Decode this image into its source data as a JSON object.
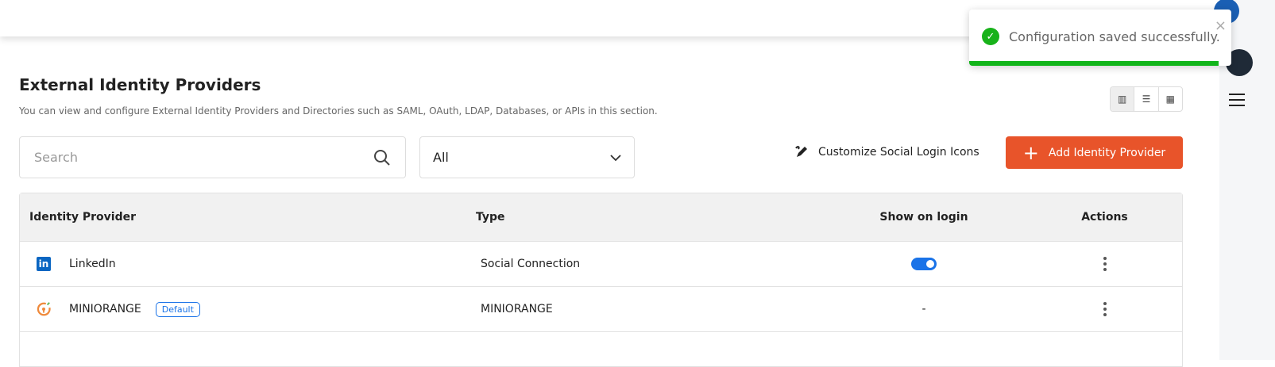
{
  "toast": {
    "message": "Configuration saved successfully.",
    "close": "×",
    "check": "✓",
    "progress": 0.95
  },
  "page": {
    "title": "External Identity Providers",
    "subtitle": "You can view and configure External Identity Providers and Directories such as SAML, OAuth, LDAP, Databases, or APIs in this section."
  },
  "search": {
    "placeholder": "Search"
  },
  "filter": {
    "selected": "All"
  },
  "actions": {
    "customize": "Customize Social Login Icons",
    "add": "Add Identity Provider",
    "plus": "+"
  },
  "table": {
    "headers": [
      "Identity Provider",
      "Type",
      "Show on login",
      "Actions"
    ],
    "rows": [
      {
        "name": "LinkedIn",
        "icon": "in",
        "badge": "",
        "type": "Social Connection",
        "show": true,
        "show_text": ""
      },
      {
        "name": "MINIORANGE",
        "icon": "",
        "badge": "Default",
        "type": "MINIORANGE",
        "show": null,
        "show_text": "-"
      }
    ]
  },
  "colors": {
    "accent": "#e8542a",
    "toggle": "#1a73e8",
    "success": "#12b51a"
  }
}
